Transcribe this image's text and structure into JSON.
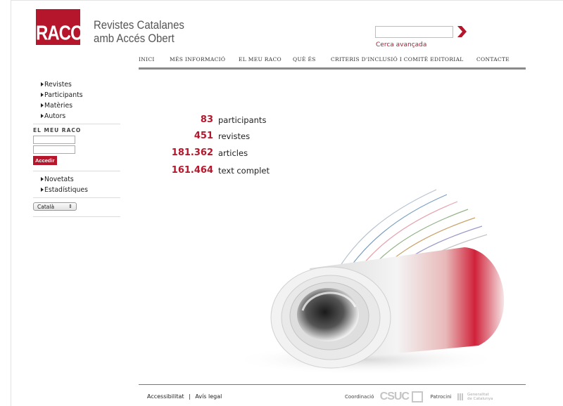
{
  "header": {
    "logo_text": "RACO",
    "title_line1": "Revistes Catalanes",
    "title_line2": "amb Accés Obert",
    "search_value": "",
    "advanced_search": "Cerca avançada"
  },
  "nav": {
    "items": [
      "INICI",
      "MÉS INFORMACIÓ",
      "EL MEU RACO",
      "QUÈ ÉS",
      "CRITERIS D'INCLUSIÓ I COMITÈ EDITORIAL",
      "CONTACTE"
    ]
  },
  "sidebar": {
    "links1": [
      "Revistes",
      "Participants",
      "Matèries",
      "Autors"
    ],
    "login_heading": "EL MEU RACO",
    "login_button": "Accedir",
    "links2": [
      "Novetats",
      "Estadístiques"
    ],
    "language": "Català"
  },
  "stats": [
    {
      "value": "83",
      "label": "participants"
    },
    {
      "value": "451",
      "label": "revistes"
    },
    {
      "value": "181.362",
      "label": "articles"
    },
    {
      "value": "161.464",
      "label": "text complet"
    }
  ],
  "footer": {
    "accessibility": "Accessibilitat",
    "separator": "|",
    "legal": "Avís legal",
    "coordination": "Coordinació",
    "csuc": "CSUC",
    "patronage": "Patrocini",
    "gencat_line1": "Generalitat",
    "gencat_line2": "de Catalunya"
  },
  "colors": {
    "accent": "#b5162b",
    "nav_rule": "#8a8a8a"
  }
}
